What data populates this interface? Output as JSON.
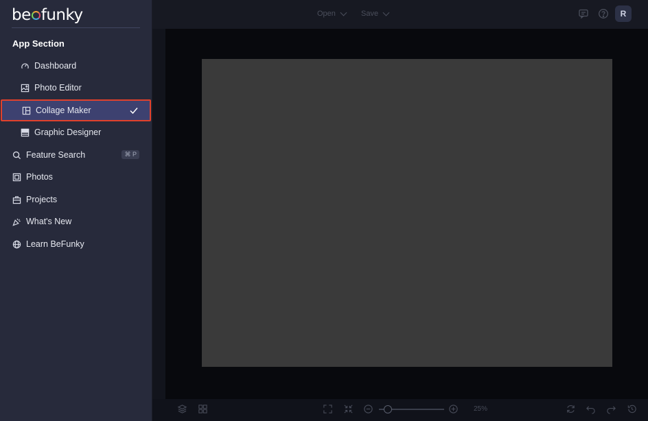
{
  "topbar": {
    "open_label": "Open",
    "save_label": "Save",
    "avatar_initial": "R",
    "icons": [
      "chat-icon",
      "help-icon"
    ]
  },
  "bottombar": {
    "zoom_label": "25%",
    "zoom_level": 0.25,
    "icons": [
      "layers-icon",
      "grid-icon",
      "fit-icon",
      "actual-size-icon",
      "zoom-out-icon",
      "zoom-in-icon",
      "reload-icon",
      "undo-icon",
      "redo-icon",
      "history-icon"
    ]
  },
  "drawer": {
    "logo_text_pre": "be",
    "logo_text_post": "funky",
    "section_title": "App Section",
    "sub_items": [
      {
        "label": "Dashboard",
        "icon": "gauge-icon"
      },
      {
        "label": "Photo Editor",
        "icon": "image-icon"
      },
      {
        "label": "Collage Maker",
        "icon": "collage-icon",
        "selected": true
      },
      {
        "label": "Graphic Designer",
        "icon": "layout-icon"
      }
    ],
    "main_items": [
      {
        "label": "Feature Search",
        "icon": "search-icon",
        "shortcut": "⌘ P"
      },
      {
        "label": "Photos",
        "icon": "photos-icon"
      },
      {
        "label": "Projects",
        "icon": "briefcase-icon"
      },
      {
        "label": "What's New",
        "icon": "party-icon"
      },
      {
        "label": "Learn BeFunky",
        "icon": "globe-icon"
      }
    ]
  }
}
